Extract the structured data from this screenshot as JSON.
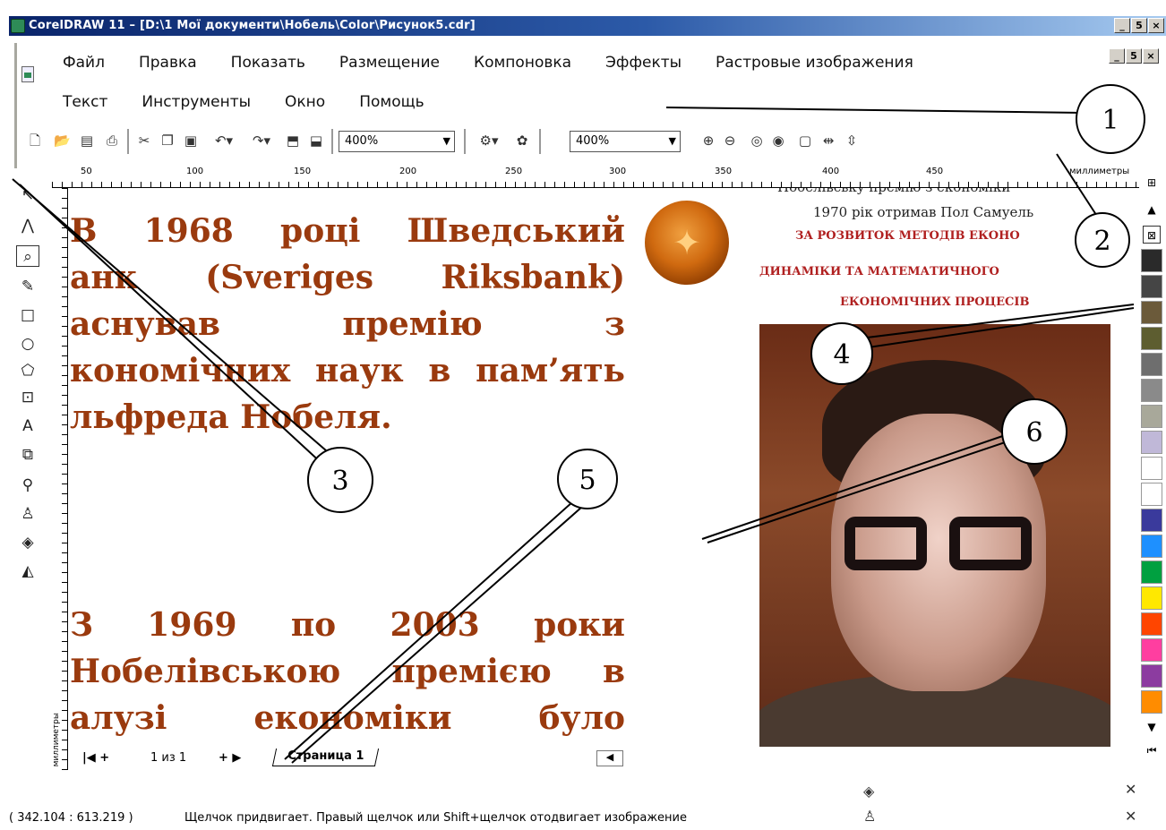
{
  "window": {
    "title": "CorelDRAW 11 – [D:\\1 Мої документи\\Нобель\\Color\\Рисунок5.cdr]",
    "controls": [
      "_",
      "5",
      "×"
    ]
  },
  "menu": {
    "row1": [
      "Файл",
      "Правка",
      "Показать",
      "Размещение",
      "Компоновка",
      "Эффекты",
      "Растровые изображения"
    ],
    "row2": [
      "Текст",
      "Инструменты",
      "Окно",
      "Помощь"
    ]
  },
  "toolbar": {
    "zoom1": "400%",
    "zoom2": "400%"
  },
  "ruler": {
    "labels": [
      "50",
      "100",
      "150",
      "200",
      "250",
      "300",
      "350",
      "400",
      "450",
      "миллиметры"
    ],
    "vertical_units": "миллиметры"
  },
  "document": {
    "para1": [
      "В 1968 році Шведський",
      "анк (Sveriges Riksbank)",
      "аснував премію з",
      "кономічних наук в пам’ять",
      "льфреда Нобеля."
    ],
    "para2": [
      "З 1969 по 2003 роки",
      "Нобелівською премією в",
      "алузі економіки було"
    ],
    "caption1": "Нобелівську премію з економіки",
    "caption2": "1970 рік отримав Пол Самуель",
    "caption3": "ЗА РОЗВИТОК МЕТОДІВ ЕКОНО",
    "caption4": "ДИНАМІКИ ТА МАТЕМАТИЧНОГО",
    "caption5": "ЕКОНОМІЧНИХ ПРОЦЕСІВ"
  },
  "page_tabs": {
    "prev_label": "1 из 1",
    "tab_label": "Страница 1"
  },
  "callouts": [
    "1",
    "2",
    "3",
    "4",
    "5",
    "6"
  ],
  "palette": {
    "colors": [
      "#2a2a2a",
      "#454545",
      "#6b5a3a",
      "#5d5d30",
      "#6e6e6e",
      "#8a8a8a",
      "#a8a89a",
      "#c0b8d8",
      "#ffffff",
      "#ffffff",
      "#3a3a9c",
      "#1e90ff",
      "#00a040",
      "#ffe800",
      "#ff4500",
      "#ff3ea0",
      "#8c3ca0",
      "#ff8c00"
    ]
  },
  "status": {
    "coords": "( 342.104 : 613.219 )",
    "hint": "Щелчок придвигает. Правый щелчок или Shift+щелчок отодвигает изображение"
  }
}
